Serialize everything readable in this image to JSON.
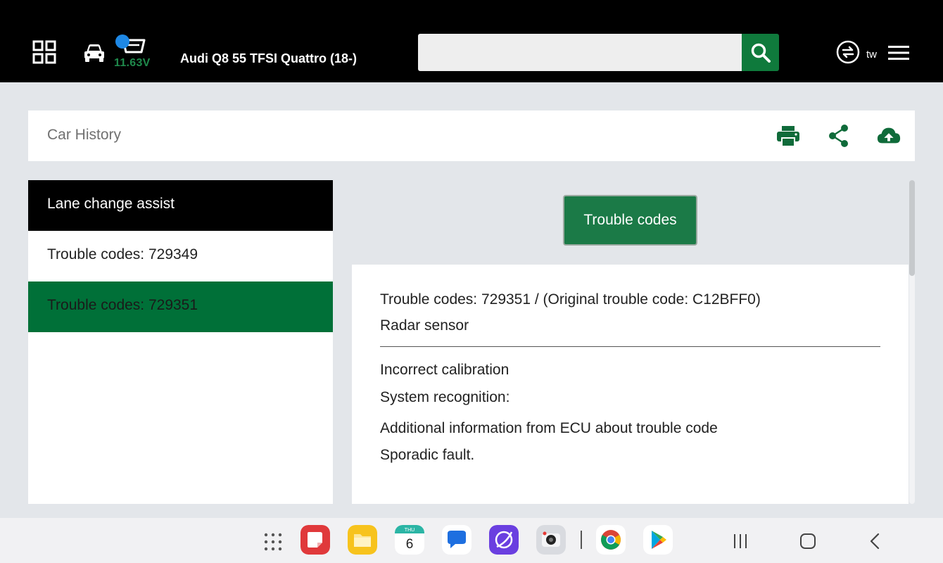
{
  "topbar": {
    "voltage": "11.63V",
    "vehicle": "Audi Q8 55 TFSI Quattro (18-)",
    "search": {
      "value": "",
      "placeholder": ""
    },
    "lang": "tw",
    "icons": [
      "grid-icon",
      "car-icon",
      "obd-connector-icon",
      "search-icon",
      "sync-icon",
      "hamburger-menu-icon"
    ],
    "accent_color": "#0f7a3c"
  },
  "history": {
    "title": "Car History",
    "icons": [
      "print-icon",
      "share-icon",
      "cloud-upload-icon"
    ]
  },
  "left_panel": {
    "header": "Lane change assist",
    "items": [
      {
        "label": "Trouble codes: 729349",
        "active": false
      },
      {
        "label": "Trouble codes: 729351",
        "active": true
      }
    ],
    "active_color": "#007038"
  },
  "detail": {
    "button": "Trouble codes",
    "code_line": "Trouble codes: 729351 / (Original trouble code: C12BFF0)",
    "component": "Radar sensor",
    "description": "Incorrect calibration",
    "system_recognition": "System recognition:",
    "additional_info": "Additional information from ECU about trouble code",
    "fault_type": "Sporadic fault."
  },
  "taskbar": {
    "calendar_day": "THU",
    "calendar_date": "6",
    "apps": [
      "app-drawer-icon",
      "notes-app-icon",
      "my-files-icon",
      "calendar-icon",
      "messages-icon",
      "internet-browser-icon",
      "camera-icon",
      "chrome-icon",
      "play-store-icon"
    ],
    "nav": [
      "recent-apps-icon",
      "home-icon",
      "back-icon"
    ]
  }
}
